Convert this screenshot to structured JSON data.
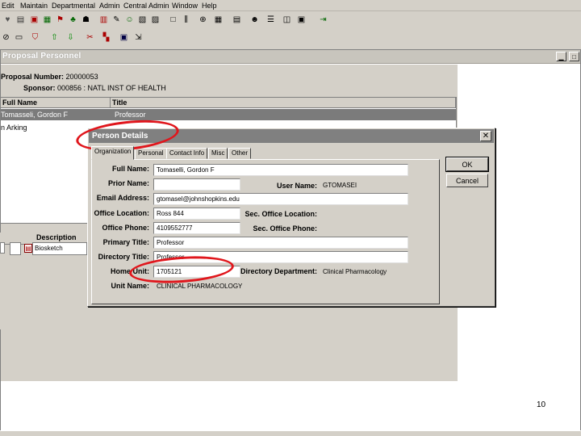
{
  "menu": [
    "Edit",
    "Maintain",
    "Departmental",
    "Admin",
    "Central Admin",
    "Window",
    "Help"
  ],
  "main_window": {
    "title": "Proposal Personnel",
    "proposal_number_label": "Proposal Number:",
    "proposal_number_value": "20000053",
    "sponsor_label": "Sponsor:",
    "sponsor_value": "000856 : NATL INST OF HEALTH",
    "grid": {
      "headers": [
        "Full Name",
        "Title"
      ],
      "rows": [
        {
          "name": "Tomasseli, Gordon F",
          "title": "Professor"
        },
        {
          "name": "n Arking",
          "title": ""
        }
      ]
    },
    "desc_header": "Description",
    "desc_value": "Biosketch"
  },
  "dialog": {
    "title": "Person Details",
    "tabs": [
      "Organization",
      "Personal",
      "Contact Info",
      "Misc",
      "Other"
    ],
    "fields": {
      "full_name_label": "Full Name:",
      "full_name_value": "Tomaselli, Gordon F",
      "prior_name_label": "Prior Name:",
      "prior_name_value": "",
      "user_name_label": "User Name:",
      "user_name_value": "GTOMASEI",
      "email_label": "Email Address:",
      "email_value": "gtomasel@johnshopkins.edu",
      "office_location_label": "Office Location:",
      "office_location_value": "Ross 844",
      "sec_office_location_label": "Sec. Office Location:",
      "sec_office_location_value": "",
      "office_phone_label": "Office Phone:",
      "office_phone_value": "4109552777",
      "sec_office_phone_label": "Sec. Office Phone:",
      "sec_office_phone_value": "",
      "primary_title_label": "Primary Title:",
      "primary_title_value": "Professor",
      "directory_title_label": "Directory Title:",
      "directory_title_value": "Professor",
      "home_unit_label": "Home Unit:",
      "home_unit_value": "1705121",
      "directory_department_label": "Directory Department:",
      "directory_department_value": "Clinical Pharmacology",
      "unit_name_label": "Unit Name:",
      "unit_name_value": "CLINICAL PHARMACOLOGY"
    },
    "buttons": {
      "ok": "OK",
      "cancel": "Cancel"
    }
  },
  "page_number": "10",
  "colors": {
    "highlight": "#e0161c",
    "selected_row": "#7b7b7b"
  }
}
